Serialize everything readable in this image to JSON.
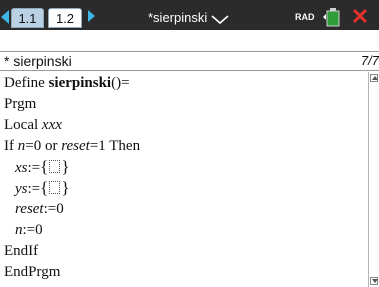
{
  "topbar": {
    "tabs": [
      {
        "label": "1.1"
      },
      {
        "label": "1.2"
      }
    ],
    "document_title": "*sierpinski",
    "status_text": "RAD",
    "colors": {
      "bar": "#2b2b2b",
      "accent": "#3fb6e8",
      "close": "#e2322b"
    }
  },
  "editor": {
    "program_name": "* sierpinski",
    "page_indicator": "7/7"
  },
  "code": {
    "line1_define": "Define ",
    "line1_name": "sierpinski",
    "line1_rest": "()=",
    "line2": "Prgm",
    "line3_kw": "Local ",
    "line3_var": "xxx",
    "line4_if": "If ",
    "line4_n": "n",
    "line4_mid": "=0 or ",
    "line4_reset": "reset",
    "line4_end": "=1 Then",
    "line5_var": "xs",
    "line5_assign": ":=",
    "line6_var": "ys",
    "line6_assign": ":=",
    "line7_var": "reset",
    "line7_assign": ":=0",
    "line8_var": "n",
    "line8_assign": ":=0",
    "line9": "EndIf",
    "line10": "EndPrgm"
  },
  "icons": {
    "prev_tab": "left-arrow-icon",
    "next_tab": "right-arrow-icon",
    "title_dropdown": "chevron-down-icon",
    "battery": "battery-icon",
    "close": "close-icon"
  }
}
